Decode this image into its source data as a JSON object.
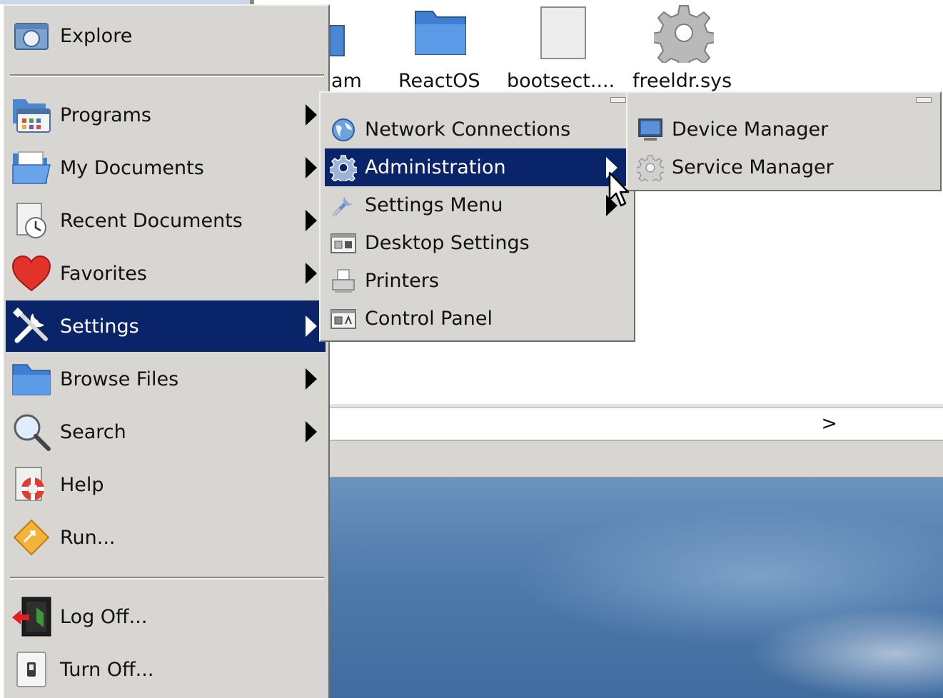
{
  "desktop": {
    "files": [
      {
        "label": "am"
      },
      {
        "label": "ReactOS"
      },
      {
        "label": "bootsect...."
      },
      {
        "label": "freeldr.sys"
      }
    ],
    "address_go": ">"
  },
  "start_menu": {
    "top_item": {
      "label": "Explore",
      "icon": "explore-icon"
    },
    "items": [
      {
        "label": "Programs",
        "icon": "programs-icon",
        "submenu": true
      },
      {
        "label": "My Documents",
        "icon": "my-documents-icon",
        "submenu": true
      },
      {
        "label": "Recent Documents",
        "icon": "recent-documents-icon",
        "submenu": true
      },
      {
        "label": "Favorites",
        "icon": "heart-icon",
        "submenu": true
      },
      {
        "label": "Settings",
        "icon": "settings-icon",
        "submenu": true,
        "selected": true
      },
      {
        "label": "Browse Files",
        "icon": "folder-icon",
        "submenu": true
      },
      {
        "label": "Search",
        "icon": "search-icon",
        "submenu": true
      },
      {
        "label": "Help",
        "icon": "help-icon",
        "submenu": false
      },
      {
        "label": "Run...",
        "icon": "run-icon",
        "submenu": false
      }
    ],
    "bottom_items": [
      {
        "label": "Log Off...",
        "icon": "log-off-icon"
      },
      {
        "label": "Turn Off...",
        "icon": "power-icon"
      }
    ]
  },
  "settings_menu": {
    "items": [
      {
        "label": "Network Connections",
        "icon": "globe-icon"
      },
      {
        "label": "Administration",
        "icon": "gear-icon",
        "submenu": true,
        "selected": true
      },
      {
        "label": "Settings Menu",
        "icon": "wrench-icon",
        "submenu": true
      },
      {
        "label": "Desktop Settings",
        "icon": "desktop-settings-icon"
      },
      {
        "label": "Printers",
        "icon": "printer-icon"
      },
      {
        "label": "Control Panel",
        "icon": "control-panel-icon"
      }
    ]
  },
  "administration_menu": {
    "items": [
      {
        "label": "Device Manager",
        "icon": "monitor-icon"
      },
      {
        "label": "Service Manager",
        "icon": "service-gear-icon"
      }
    ]
  },
  "colors": {
    "menu_bg": "#d8d6d2",
    "selection": "#0a246a",
    "selection_text": "#ffffff"
  }
}
